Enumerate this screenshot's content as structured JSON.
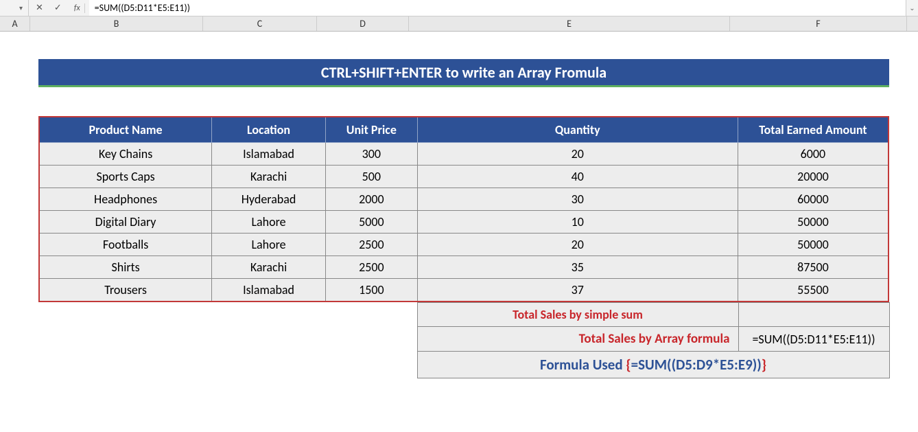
{
  "formula_bar": {
    "cancel": "✕",
    "accept": "✓",
    "fx": "fx",
    "formula": "=SUM((D5:D11*E5:E11))"
  },
  "columns": {
    "A": "A",
    "B": "B",
    "C": "C",
    "D": "D",
    "E": "E",
    "F": "F"
  },
  "title": "CTRL+SHIFT+ENTER to write an Array Fromula",
  "headers": {
    "product": "Product Name",
    "location": "Location",
    "unitprice": "Unit Price",
    "quantity": "Quantity",
    "total": "Total Earned Amount"
  },
  "rows": [
    {
      "product": "Key Chains",
      "location": "Islamabad",
      "unitprice": "300",
      "quantity": "20",
      "total": "6000"
    },
    {
      "product": "Sports Caps",
      "location": "Karachi",
      "unitprice": "500",
      "quantity": "40",
      "total": "20000"
    },
    {
      "product": "Headphones",
      "location": "Hyderabad",
      "unitprice": "2000",
      "quantity": "30",
      "total": "60000"
    },
    {
      "product": "Digital Diary",
      "location": "Lahore",
      "unitprice": "5000",
      "quantity": "10",
      "total": "50000"
    },
    {
      "product": "Footballs",
      "location": "Lahore",
      "unitprice": "2500",
      "quantity": "20",
      "total": "50000"
    },
    {
      "product": "Shirts",
      "location": "Karachi",
      "unitprice": "2500",
      "quantity": "35",
      "total": "87500"
    },
    {
      "product": "Trousers",
      "location": "Islamabad",
      "unitprice": "1500",
      "quantity": "37",
      "total": "55500"
    }
  ],
  "summary": {
    "simple_label": "Total Sales by simple sum",
    "simple_value": "",
    "array_label": "Total Sales by Array formula",
    "array_formula": "=SUM((D5:D11*E5:E11))",
    "used_label": "Formula Used ",
    "used_open": "{",
    "used_body": "=SUM((D5:D9*E5:E9))",
    "used_close": "}"
  }
}
